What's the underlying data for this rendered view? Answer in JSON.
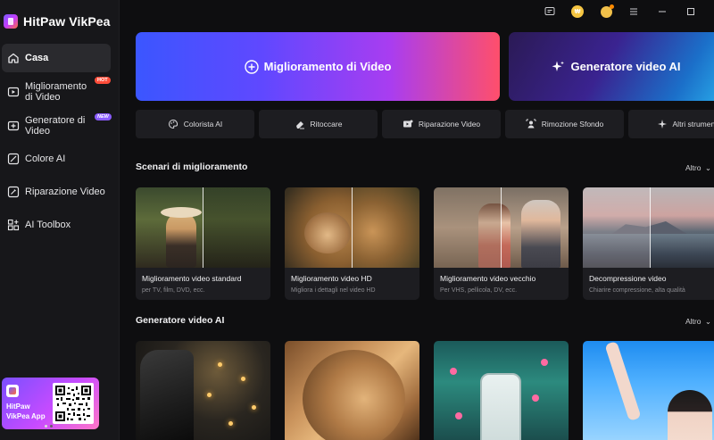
{
  "app": {
    "name": "HitPaw VikPea"
  },
  "sidebar": {
    "items": [
      {
        "label": "Casa",
        "icon": "home-icon",
        "active": true
      },
      {
        "label": "Miglioramento di Video",
        "icon": "video-enhance-icon",
        "badge": "Hot"
      },
      {
        "label": "Generatore di Video",
        "icon": "video-generator-icon",
        "badge": "New"
      },
      {
        "label": "Colore AI",
        "icon": "color-icon"
      },
      {
        "label": "Riparazione Video",
        "icon": "video-repair-icon"
      },
      {
        "label": "AI Toolbox",
        "icon": "toolbox-icon"
      }
    ],
    "promo": {
      "text": "HitPaw VikPea App"
    }
  },
  "main": {
    "hero": [
      {
        "label": "Miglioramento di Video",
        "icon": "plus-circle-icon"
      },
      {
        "label": "Generatore video AI",
        "icon": "sparkle-icon"
      }
    ],
    "tools": [
      {
        "label": "Colorista AI",
        "icon": "palette-icon"
      },
      {
        "label": "Ritoccare",
        "icon": "eraser-icon"
      },
      {
        "label": "Riparazione Video",
        "icon": "repair-icon"
      },
      {
        "label": "Rimozione Sfondo",
        "icon": "background-remove-icon"
      },
      {
        "label": "Altri strumenti",
        "icon": "sparkle-icon"
      }
    ],
    "scenarios": {
      "title": "Scenari di miglioramento",
      "more": "Altro",
      "cards": [
        {
          "title": "Miglioramento video standard",
          "subtitle": "per TV, film, DVD, ecc."
        },
        {
          "title": "Miglioramento video HD",
          "subtitle": "Migliora i dettagli nel video HD"
        },
        {
          "title": "Miglioramento video vecchio",
          "subtitle": "Per VHS, pellicola, DV, ecc."
        },
        {
          "title": "Decompressione video",
          "subtitle": "Chiarire compressione, alta qualità"
        }
      ]
    },
    "generator": {
      "title": "Generatore video AI",
      "more": "Altro"
    }
  },
  "colors": {
    "background": "#0e0e10",
    "sidebar": "#17171a",
    "accent_purple": "#6048ff",
    "badge_hot": "#ff4d3a",
    "badge_new": "#8a5cff"
  }
}
